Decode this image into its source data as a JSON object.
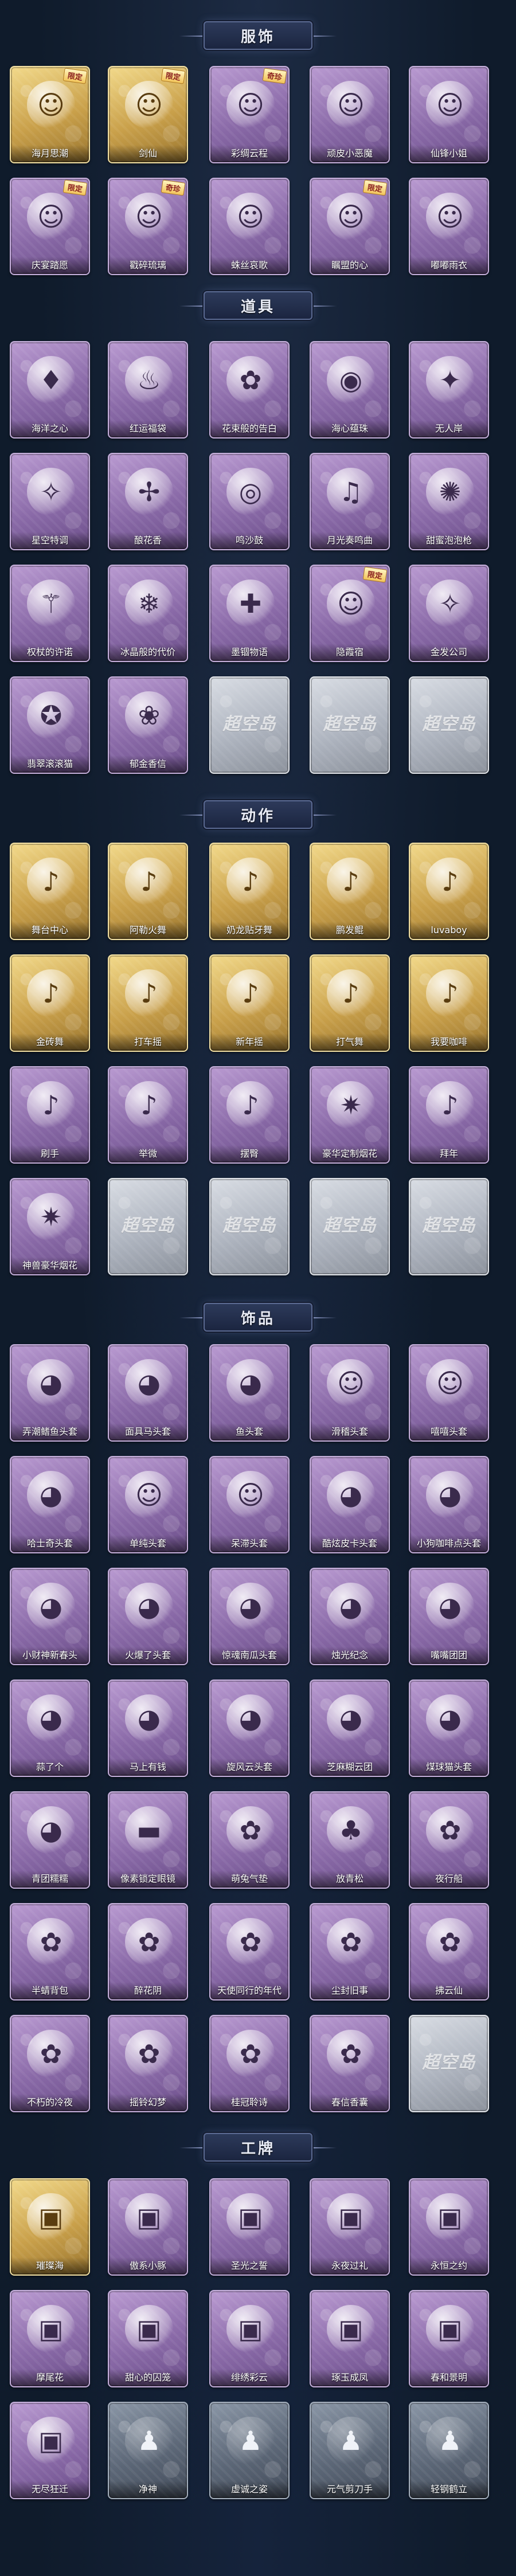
{
  "sections": [
    {
      "title": "服饰",
      "items": [
        {
          "label": "海月思潮",
          "style": "gold",
          "icon": "character-portrait-icon",
          "glyph": "☺",
          "badge": "限定"
        },
        {
          "label": "剑仙",
          "style": "gold",
          "icon": "character-portrait-icon",
          "glyph": "☺",
          "badge": "限定"
        },
        {
          "label": "彩绸云程",
          "style": "purple",
          "icon": "character-portrait-icon",
          "glyph": "☺",
          "badge": "奇珍"
        },
        {
          "label": "顽皮小恶魔",
          "style": "purple",
          "icon": "character-portrait-icon",
          "glyph": "☺",
          "badge": ""
        },
        {
          "label": "仙锋小姐",
          "style": "purple",
          "icon": "character-portrait-icon",
          "glyph": "☺",
          "badge": ""
        },
        {
          "label": "庆宴踏愿",
          "style": "purple",
          "icon": "character-portrait-icon",
          "glyph": "☺",
          "badge": "限定"
        },
        {
          "label": "戳碎琉璃",
          "style": "purple",
          "icon": "character-portrait-icon",
          "glyph": "☺",
          "badge": "奇珍"
        },
        {
          "label": "蛛丝哀歌",
          "style": "purple",
          "icon": "character-portrait-icon",
          "glyph": "☺",
          "badge": ""
        },
        {
          "label": "瞩盟的心",
          "style": "purple",
          "icon": "character-portrait-icon",
          "glyph": "☺",
          "badge": "限定"
        },
        {
          "label": "嘟嘟雨衣",
          "style": "purple",
          "icon": "character-portrait-icon",
          "glyph": "☺",
          "badge": ""
        }
      ]
    },
    {
      "title": "道具",
      "items": [
        {
          "label": "海洋之心",
          "style": "purple",
          "icon": "pendant-icon",
          "glyph": "♦"
        },
        {
          "label": "红运福袋",
          "style": "purple",
          "icon": "pouch-icon",
          "glyph": "♨"
        },
        {
          "label": "花束般的告白",
          "style": "purple",
          "icon": "rose-icon",
          "glyph": "✿"
        },
        {
          "label": "海心蕴珠",
          "style": "purple",
          "icon": "shell-icon",
          "glyph": "◉"
        },
        {
          "label": "无人岸",
          "style": "purple",
          "icon": "prop-icon",
          "glyph": "✦"
        },
        {
          "label": "星空特调",
          "style": "purple",
          "icon": "bottle-icon",
          "glyph": "✧"
        },
        {
          "label": "酿花香",
          "style": "purple",
          "icon": "antler-icon",
          "glyph": "✢"
        },
        {
          "label": "鸣沙鼓",
          "style": "purple",
          "icon": "drum-icon",
          "glyph": "◎"
        },
        {
          "label": "月光奏鸣曲",
          "style": "purple",
          "icon": "music-box-icon",
          "glyph": "♫"
        },
        {
          "label": "甜蜜泡泡枪",
          "style": "purple",
          "icon": "bubble-gun-icon",
          "glyph": "✺"
        },
        {
          "label": "权杖的许诺",
          "style": "purple",
          "icon": "scepter-icon",
          "glyph": "⚚"
        },
        {
          "label": "冰晶般的代价",
          "style": "purple",
          "icon": "ice-crystal-icon",
          "glyph": "❄"
        },
        {
          "label": "墨锢物语",
          "style": "purple",
          "icon": "medical-box-icon",
          "glyph": "✚",
          "badge": ""
        },
        {
          "label": "隐霞宿",
          "style": "purple",
          "icon": "character-portrait-icon",
          "glyph": "☺",
          "badge": "限定"
        },
        {
          "label": "金发公司",
          "style": "purple",
          "icon": "bottle-icon",
          "glyph": "✧"
        },
        {
          "label": "翡翠滚滚猫",
          "style": "purple",
          "icon": "potion-icon",
          "glyph": "✪"
        },
        {
          "label": "郁金香信",
          "style": "purple",
          "icon": "wreath-icon",
          "glyph": "❀"
        },
        {
          "label": "",
          "style": "grey",
          "icon": "locked-placeholder-icon",
          "locked": "超空岛"
        },
        {
          "label": "",
          "style": "grey",
          "icon": "locked-placeholder-icon",
          "locked": "超空岛"
        },
        {
          "label": "",
          "style": "grey",
          "icon": "locked-placeholder-icon",
          "locked": "超空岛"
        }
      ]
    },
    {
      "title": "动作",
      "items": [
        {
          "label": "舞台中心",
          "style": "gold",
          "icon": "action-pose-icon",
          "glyph": "♪"
        },
        {
          "label": "阿勒火舞",
          "style": "gold",
          "icon": "action-pose-icon",
          "glyph": "♪"
        },
        {
          "label": "奶龙贴牙舞",
          "style": "gold",
          "icon": "action-pose-icon",
          "glyph": "♪"
        },
        {
          "label": "鹏发鲲",
          "style": "gold",
          "icon": "action-pose-icon",
          "glyph": "♪"
        },
        {
          "label": "luvaboy",
          "style": "gold",
          "icon": "action-pose-icon",
          "glyph": "♪"
        },
        {
          "label": "金砖舞",
          "style": "gold",
          "icon": "action-pose-icon",
          "glyph": "♪"
        },
        {
          "label": "打车摇",
          "style": "gold",
          "icon": "action-pose-icon",
          "glyph": "♪"
        },
        {
          "label": "新年摇",
          "style": "gold",
          "icon": "action-pose-icon",
          "glyph": "♪"
        },
        {
          "label": "打气舞",
          "style": "gold",
          "icon": "action-pose-icon",
          "glyph": "♪"
        },
        {
          "label": "我要咖啡",
          "style": "gold",
          "icon": "action-pose-icon",
          "glyph": "♪"
        },
        {
          "label": "刷手",
          "style": "purple",
          "icon": "action-pose-icon",
          "glyph": "♪"
        },
        {
          "label": "举微",
          "style": "purple",
          "icon": "action-pose-icon",
          "glyph": "♪"
        },
        {
          "label": "摆臀",
          "style": "purple",
          "icon": "action-pose-icon",
          "glyph": "♪"
        },
        {
          "label": "豪华定制烟花",
          "style": "purple",
          "icon": "firework-icon",
          "glyph": "✷"
        },
        {
          "label": "拜年",
          "style": "purple",
          "icon": "action-pose-icon",
          "glyph": "♪"
        },
        {
          "label": "神兽豪华烟花",
          "style": "purple",
          "icon": "firework-icon",
          "glyph": "✷"
        },
        {
          "label": "",
          "style": "grey",
          "icon": "locked-placeholder-icon",
          "locked": "超空岛"
        },
        {
          "label": "",
          "style": "grey",
          "icon": "locked-placeholder-icon",
          "locked": "超空岛"
        },
        {
          "label": "",
          "style": "grey",
          "icon": "locked-placeholder-icon",
          "locked": "超空岛"
        },
        {
          "label": "",
          "style": "grey",
          "icon": "locked-placeholder-icon",
          "locked": "超空岛"
        }
      ]
    },
    {
      "title": "饰品",
      "items": [
        {
          "label": "弄潮鳍鱼头套",
          "style": "purple",
          "icon": "mask-icon",
          "glyph": "◕"
        },
        {
          "label": "面具马头套",
          "style": "purple",
          "icon": "mask-icon",
          "glyph": "◕"
        },
        {
          "label": "鱼头套",
          "style": "purple",
          "icon": "mask-icon",
          "glyph": "◕"
        },
        {
          "label": "滑稽头套",
          "style": "purple",
          "icon": "emoji-mask-icon",
          "glyph": "☺"
        },
        {
          "label": "嘻嘻头套",
          "style": "purple",
          "icon": "emoji-mask-icon",
          "glyph": "☺"
        },
        {
          "label": "哈士奇头套",
          "style": "purple",
          "icon": "mask-icon",
          "glyph": "◕"
        },
        {
          "label": "单纯头套",
          "style": "purple",
          "icon": "emoji-mask-icon",
          "glyph": "☺"
        },
        {
          "label": "呆滞头套",
          "style": "purple",
          "icon": "emoji-mask-icon",
          "glyph": "☺"
        },
        {
          "label": "酷炫皮卡头套",
          "style": "purple",
          "icon": "mask-icon",
          "glyph": "◕"
        },
        {
          "label": "小狗咖啡点头套",
          "style": "purple",
          "icon": "mask-icon",
          "glyph": "◕"
        },
        {
          "label": "小财神新春头",
          "style": "purple",
          "icon": "mask-icon",
          "glyph": "◕"
        },
        {
          "label": "火爆了头套",
          "style": "purple",
          "icon": "mask-icon",
          "glyph": "◕"
        },
        {
          "label": "惊魂南瓜头套",
          "style": "purple",
          "icon": "pumpkin-icon",
          "glyph": "◕"
        },
        {
          "label": "烛光纪念",
          "style": "purple",
          "icon": "mask-icon",
          "glyph": "◕"
        },
        {
          "label": "嘴嘴团团",
          "style": "purple",
          "icon": "mask-icon",
          "glyph": "◕"
        },
        {
          "label": "蒜了个",
          "style": "purple",
          "icon": "mask-icon",
          "glyph": "◕"
        },
        {
          "label": "马上有钱",
          "style": "purple",
          "icon": "mask-icon",
          "glyph": "◕"
        },
        {
          "label": "旋风云头套",
          "style": "purple",
          "icon": "mask-icon",
          "glyph": "◕"
        },
        {
          "label": "芝麻糊云团",
          "style": "purple",
          "icon": "mask-icon",
          "glyph": "◕"
        },
        {
          "label": "煤球猫头套",
          "style": "purple",
          "icon": "mask-icon",
          "glyph": "◕"
        },
        {
          "label": "青团糯糯",
          "style": "purple",
          "icon": "mask-icon",
          "glyph": "◕"
        },
        {
          "label": "像素锁定眼镜",
          "style": "purple",
          "icon": "sunglasses-icon",
          "glyph": "▬"
        },
        {
          "label": "萌兔气垫",
          "style": "purple",
          "icon": "accessory-icon",
          "glyph": "✿"
        },
        {
          "label": "放青松",
          "style": "purple",
          "icon": "bonsai-icon",
          "glyph": "♣"
        },
        {
          "label": "夜行船",
          "style": "purple",
          "icon": "accessory-icon",
          "glyph": "✿"
        },
        {
          "label": "半蜻背包",
          "style": "purple",
          "icon": "backpack-icon",
          "glyph": "✿"
        },
        {
          "label": "醉花阴",
          "style": "purple",
          "icon": "accessory-icon",
          "glyph": "✿"
        },
        {
          "label": "天使同行的年代",
          "style": "purple",
          "icon": "accessory-icon",
          "glyph": "✿"
        },
        {
          "label": "尘封旧事",
          "style": "purple",
          "icon": "accessory-icon",
          "glyph": "✿"
        },
        {
          "label": "拂云仙",
          "style": "purple",
          "icon": "accessory-icon",
          "glyph": "✿"
        },
        {
          "label": "不朽的冷夜",
          "style": "purple",
          "icon": "accessory-icon",
          "glyph": "✿"
        },
        {
          "label": "摇铃幻梦",
          "style": "purple",
          "icon": "accessory-icon",
          "glyph": "✿"
        },
        {
          "label": "桂冠聆诗",
          "style": "purple",
          "icon": "accessory-icon",
          "glyph": "✿"
        },
        {
          "label": "春信香囊",
          "style": "purple",
          "icon": "accessory-icon",
          "glyph": "✿"
        },
        {
          "label": "",
          "style": "grey",
          "icon": "locked-placeholder-icon",
          "locked": "超空岛"
        }
      ]
    },
    {
      "title": "工牌",
      "items": [
        {
          "label": "璀璨海",
          "style": "gold",
          "icon": "badge-card-icon",
          "glyph": "▣"
        },
        {
          "label": "傲系小豚",
          "style": "purple",
          "icon": "badge-card-icon",
          "glyph": "▣"
        },
        {
          "label": "圣光之誓",
          "style": "purple",
          "icon": "badge-card-icon",
          "glyph": "▣"
        },
        {
          "label": "永夜过礼",
          "style": "purple",
          "icon": "badge-card-icon",
          "glyph": "▣"
        },
        {
          "label": "永恒之约",
          "style": "purple",
          "icon": "badge-card-icon",
          "glyph": "▣"
        },
        {
          "label": "摩尾花",
          "style": "purple",
          "icon": "badge-card-icon",
          "glyph": "▣"
        },
        {
          "label": "甜心的囚笼",
          "style": "purple",
          "icon": "badge-card-icon",
          "glyph": "▣"
        },
        {
          "label": "绯绣彩云",
          "style": "purple",
          "icon": "badge-card-icon",
          "glyph": "▣"
        },
        {
          "label": "琢玉成凤",
          "style": "purple",
          "icon": "badge-card-icon",
          "glyph": "▣"
        },
        {
          "label": "春和景明",
          "style": "purple",
          "icon": "badge-card-icon",
          "glyph": "▣"
        },
        {
          "label": "无尽狂迁",
          "style": "purple",
          "icon": "badge-card-icon",
          "glyph": "▣"
        },
        {
          "label": "净神",
          "style": "dark",
          "icon": "silhouette-icon",
          "glyph": "♟"
        },
        {
          "label": "虚诚之姿",
          "style": "dark",
          "icon": "silhouette-icon",
          "glyph": "♟"
        },
        {
          "label": "元气剪刀手",
          "style": "dark",
          "icon": "silhouette-icon",
          "glyph": "♟"
        },
        {
          "label": "轻钢鹤立",
          "style": "dark",
          "icon": "silhouette-icon",
          "glyph": "♟"
        }
      ]
    }
  ]
}
